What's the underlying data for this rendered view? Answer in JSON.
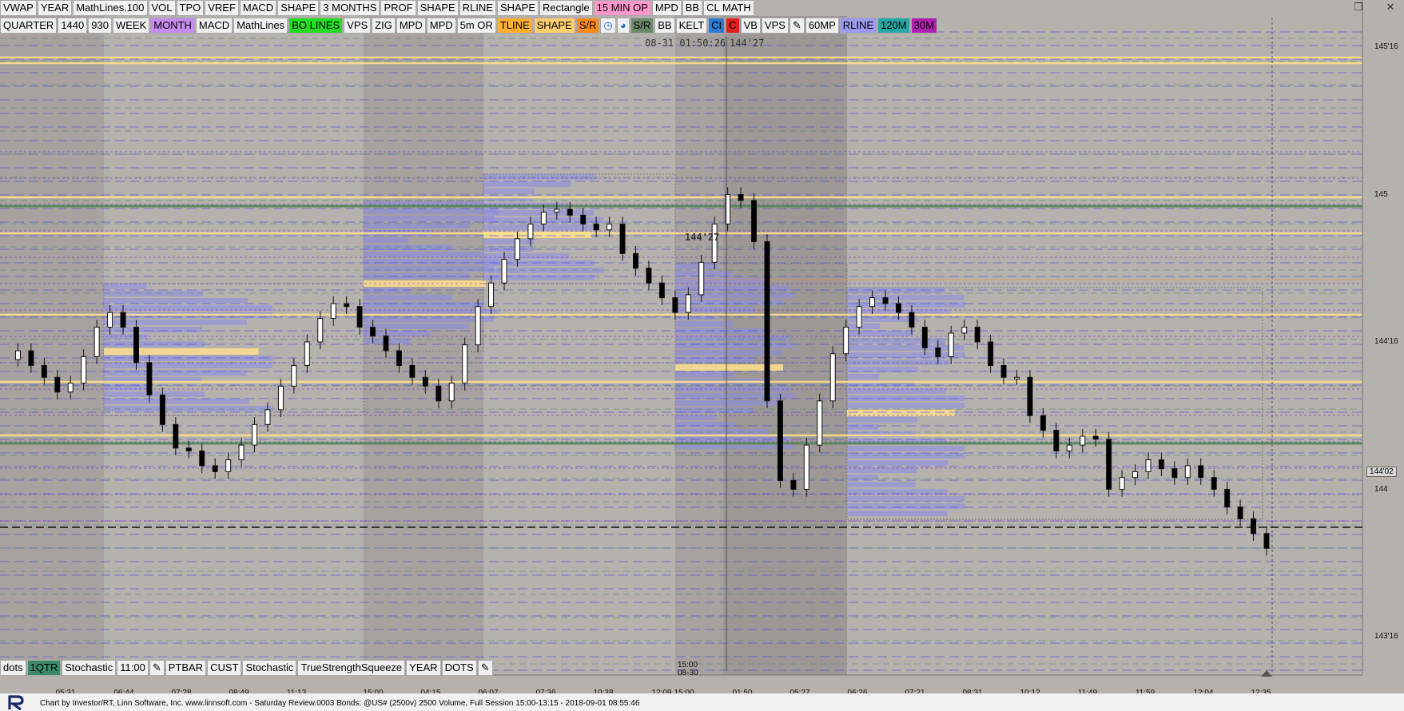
{
  "toolbar_top": [
    {
      "label": "VWAP",
      "bg": "#f0f0f0",
      "fg": "#000000"
    },
    {
      "label": "YEAR",
      "bg": "#f0f0f0",
      "fg": "#000000"
    },
    {
      "label": "MathLines.100",
      "bg": "#f0f0f0",
      "fg": "#000000"
    },
    {
      "label": "VOL",
      "bg": "#f0f0f0",
      "fg": "#000000"
    },
    {
      "label": "TPO",
      "bg": "#f0f0f0",
      "fg": "#000000"
    },
    {
      "label": "VREF",
      "bg": "#f0f0f0",
      "fg": "#000000"
    },
    {
      "label": "MACD",
      "bg": "#f0f0f0",
      "fg": "#000000"
    },
    {
      "label": "SHAPE",
      "bg": "#f0f0f0",
      "fg": "#000000"
    },
    {
      "label": "3 MONTHS",
      "bg": "#f0f0f0",
      "fg": "#000000"
    },
    {
      "label": "PROF",
      "bg": "#f0f0f0",
      "fg": "#000000"
    },
    {
      "label": "SHAPE",
      "bg": "#f0f0f0",
      "fg": "#000000"
    },
    {
      "label": "RLINE",
      "bg": "#f0f0f0",
      "fg": "#000000"
    },
    {
      "label": "SHAPE",
      "bg": "#f0f0f0",
      "fg": "#000000"
    },
    {
      "label": "Rectangle",
      "bg": "#f0f0f0",
      "fg": "#000000"
    },
    {
      "label": "15 MIN OP",
      "bg": "#ff99cc",
      "fg": "#000000"
    },
    {
      "label": "MPD",
      "bg": "#f0f0f0",
      "fg": "#000000"
    },
    {
      "label": "BB",
      "bg": "#f0f0f0",
      "fg": "#000000"
    },
    {
      "label": "CL MATH",
      "bg": "#f0f0f0",
      "fg": "#000000"
    }
  ],
  "toolbar_second": [
    {
      "label": "QUARTER",
      "bg": "#f0f0f0",
      "fg": "#000000"
    },
    {
      "label": "1440",
      "bg": "#f0f0f0",
      "fg": "#000000"
    },
    {
      "label": "930",
      "bg": "#f0f0f0",
      "fg": "#000000"
    },
    {
      "label": "WEEK",
      "bg": "#f0f0f0",
      "fg": "#000000"
    },
    {
      "label": "MONTH",
      "bg": "#c78bf0",
      "fg": "#000000"
    },
    {
      "label": "MACD",
      "bg": "#f0f0f0",
      "fg": "#000000"
    },
    {
      "label": "MathLines",
      "bg": "#f0f0f0",
      "fg": "#000000"
    },
    {
      "label": "BO LINES",
      "bg": "#22dd22",
      "fg": "#000000"
    },
    {
      "label": "VPS",
      "bg": "#f0f0f0",
      "fg": "#000000"
    },
    {
      "label": "ZIG",
      "bg": "#f0f0f0",
      "fg": "#000000"
    },
    {
      "label": "MPD",
      "bg": "#f0f0f0",
      "fg": "#000000"
    },
    {
      "label": "MPD",
      "bg": "#f0f0f0",
      "fg": "#000000"
    },
    {
      "label": "5m OR",
      "bg": "#f0f0f0",
      "fg": "#000000"
    },
    {
      "label": "TLINE",
      "bg": "#ffb030",
      "fg": "#000000"
    },
    {
      "label": "SHAPE",
      "bg": "#ffd070",
      "fg": "#000000"
    },
    {
      "label": "S/R",
      "bg": "#ff8c1a",
      "fg": "#000000"
    },
    {
      "label": "◷",
      "bg": "#f0f0f0",
      "fg": "#1a6ad8"
    },
    {
      "label": "◕",
      "bg": "#f0f0f0",
      "fg": "#1a6ad8"
    },
    {
      "label": "S/R",
      "bg": "#6a8a6a",
      "fg": "#000000"
    },
    {
      "label": "BB",
      "bg": "#f0f0f0",
      "fg": "#000000"
    },
    {
      "label": "KELT",
      "bg": "#f0f0f0",
      "fg": "#000000"
    },
    {
      "label": "CI",
      "bg": "#2a7ad8",
      "fg": "#000000"
    },
    {
      "label": "C",
      "bg": "#e02020",
      "fg": "#000000"
    },
    {
      "label": "VB",
      "bg": "#f0f0f0",
      "fg": "#000000"
    },
    {
      "label": "VPS",
      "bg": "#f0f0f0",
      "fg": "#000000"
    },
    {
      "label": "✎",
      "bg": "#f0f0f0",
      "fg": "#000000"
    },
    {
      "label": "60MP",
      "bg": "#f0f0f0",
      "fg": "#000000"
    },
    {
      "label": "RLINE",
      "bg": "#9a9af0",
      "fg": "#000000"
    },
    {
      "label": "120M",
      "bg": "#2aa6a6",
      "fg": "#000000"
    },
    {
      "label": "30M",
      "bg": "#b020b0",
      "fg": "#000000"
    }
  ],
  "toolbar_bottom": [
    {
      "label": "dots",
      "bg": "#f0f0f0",
      "fg": "#000000"
    },
    {
      "label": "1QTR",
      "bg": "#3a8a6a",
      "fg": "#000000"
    },
    {
      "label": "Stochastic",
      "bg": "#f0f0f0",
      "fg": "#000000"
    },
    {
      "label": "11:00",
      "bg": "#f0f0f0",
      "fg": "#000000"
    },
    {
      "label": "✎",
      "bg": "#f0f0f0",
      "fg": "#000000"
    },
    {
      "label": "PTBAR",
      "bg": "#f0f0f0",
      "fg": "#000000"
    },
    {
      "label": "CUST",
      "bg": "#f0f0f0",
      "fg": "#000000"
    },
    {
      "label": "Stochastic",
      "bg": "#f0f0f0",
      "fg": "#000000"
    },
    {
      "label": "TrueStrengthSqueeze",
      "bg": "#f0f0f0",
      "fg": "#000000"
    },
    {
      "label": "YEAR",
      "bg": "#f0f0f0",
      "fg": "#000000"
    },
    {
      "label": "DOTS",
      "bg": "#f0f0f0",
      "fg": "#000000"
    },
    {
      "label": "✎",
      "bg": "#f0f0f0",
      "fg": "#000000"
    }
  ],
  "window": {
    "restore_icon": "❐",
    "close_icon": "✕"
  },
  "cursor": {
    "datetime": "08-31 01:50:26",
    "price": "144'27"
  },
  "price_callout": "144'27",
  "current_price_label": "144'02",
  "price_axis": [
    {
      "label": "145'16",
      "price": 145.5
    },
    {
      "label": "145",
      "price": 145.0
    },
    {
      "label": "144'16",
      "price": 144.5
    },
    {
      "label": "144",
      "price": 144.0
    },
    {
      "label": "143'16",
      "price": 143.5
    }
  ],
  "time_axis": [
    "05:31",
    "06:44",
    "07:28",
    "08:49",
    "11:13",
    "15:00",
    "04:15",
    "06:07",
    "07:36",
    "10:38",
    "12:09",
    "15:00",
    "01:50",
    "05:27",
    "06:26",
    "07:21",
    "08:31",
    "10:12",
    "11:49",
    "11:59",
    "12:04",
    "12:35"
  ],
  "session_label": {
    "time": "15:00",
    "date": "08-30"
  },
  "status_text": "Chart by Investor/RT, Linn Software, Inc. www.linnsoft.com - Saturday Review.0003  Bonds: @US# (2500v) 2500 Volume, Full Session 15:00-13:15 - 2018-09-01 08:55:46",
  "colors": {
    "background": "#b5b1ad",
    "shade": "#9a9693",
    "yellow_line": "#ffe08a",
    "blue_dash": "#4040e0",
    "green_line": "#5a8a5a",
    "profile_blue": "#8a8ae8",
    "candle_up": "#ffffff",
    "candle_down": "#000000"
  },
  "chart_data": {
    "type": "candlestick",
    "instrument": "@US#",
    "bar_type": "2500 Volume",
    "current_price": 144.0625,
    "closes": [
      144.44,
      144.47,
      144.42,
      144.38,
      144.33,
      144.36,
      144.45,
      144.55,
      144.6,
      144.55,
      144.43,
      144.32,
      144.22,
      144.14,
      144.13,
      144.08,
      144.06,
      144.1,
      144.15,
      144.22,
      144.27,
      144.35,
      144.42,
      144.5,
      144.58,
      144.63,
      144.62,
      144.55,
      144.52,
      144.47,
      144.42,
      144.38,
      144.35,
      144.3,
      144.36,
      144.49,
      144.62,
      144.7,
      144.78,
      144.85,
      144.9,
      144.94,
      144.95,
      144.93,
      144.9,
      144.88,
      144.9,
      144.8,
      144.75,
      144.7,
      144.65,
      144.6,
      144.66,
      144.77,
      144.9,
      145.0,
      144.98,
      144.84,
      144.3,
      144.03,
      144.0,
      144.15,
      144.3,
      144.46,
      144.55,
      144.62,
      144.65,
      144.63,
      144.6,
      144.55,
      144.48,
      144.45,
      144.53,
      144.55,
      144.5,
      144.42,
      144.38,
      144.38,
      144.25,
      144.2,
      144.13,
      144.15,
      144.18,
      144.17,
      144.0,
      144.04,
      144.06,
      144.1,
      144.07,
      144.04,
      144.08,
      144.04,
      144.0,
      143.94,
      143.9,
      143.85,
      143.8
    ]
  }
}
